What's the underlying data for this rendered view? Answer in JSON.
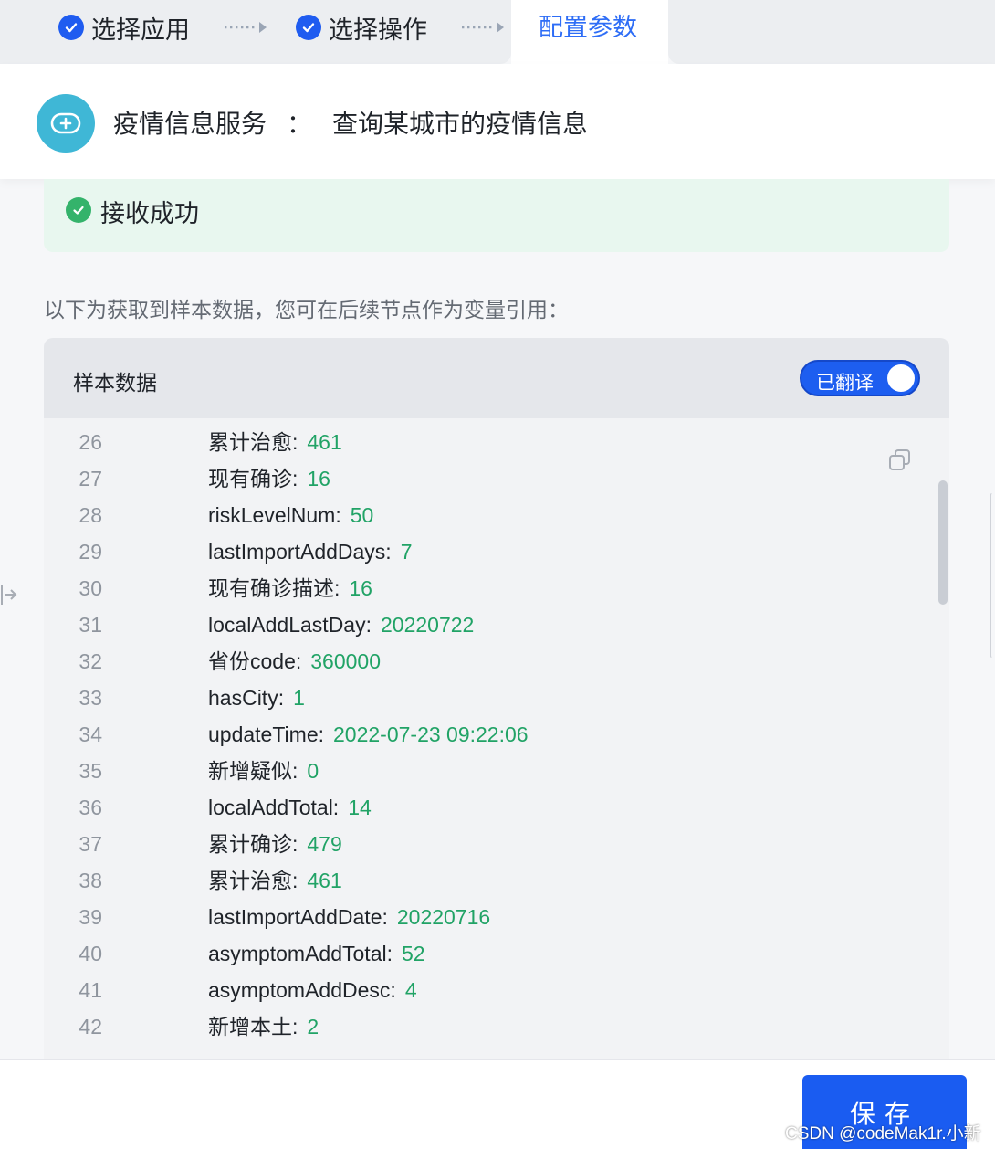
{
  "steps": [
    {
      "label": "选择应用",
      "status": "done"
    },
    {
      "label": "选择操作",
      "status": "done"
    },
    {
      "label": "配置参数",
      "status": "active"
    }
  ],
  "header": {
    "app_name": "疫情信息服务",
    "separator": "：",
    "action_name": "查询某城市的疫情信息",
    "logo_icon": "medical-kit-icon",
    "logo_color": "#3fb7d6"
  },
  "status": {
    "text": "接收成功",
    "icon": "check-circle-icon",
    "color": "#34b36b"
  },
  "description": "以下为获取到样本数据，您可在后续节点作为变量引用：",
  "sample": {
    "title": "样本数据",
    "toggle_label": "已翻译",
    "toggle_on": true,
    "lines": [
      {
        "num": "26",
        "key": "累计治愈:",
        "value": "461"
      },
      {
        "num": "27",
        "key": "现有确诊:",
        "value": "16"
      },
      {
        "num": "28",
        "key": "riskLevelNum:",
        "value": "50"
      },
      {
        "num": "29",
        "key": "lastImportAddDays:",
        "value": "7"
      },
      {
        "num": "30",
        "key": "现有确诊描述:",
        "value": "16"
      },
      {
        "num": "31",
        "key": "localAddLastDay:",
        "value": "20220722"
      },
      {
        "num": "32",
        "key": "省份code:",
        "value": "360000"
      },
      {
        "num": "33",
        "key": "hasCity:",
        "value": "1"
      },
      {
        "num": "34",
        "key": "updateTime:",
        "value": "2022-07-23 09:22:06"
      },
      {
        "num": "35",
        "key": "新增疑似:",
        "value": "0"
      },
      {
        "num": "36",
        "key": "localAddTotal:",
        "value": "14"
      },
      {
        "num": "37",
        "key": "累计确诊:",
        "value": "479"
      },
      {
        "num": "38",
        "key": "累计治愈:",
        "value": "461"
      },
      {
        "num": "39",
        "key": "lastImportAddDate:",
        "value": "20220716"
      },
      {
        "num": "40",
        "key": "asymptomAddTotal:",
        "value": "52"
      },
      {
        "num": "41",
        "key": "asymptomAddDesc:",
        "value": "4"
      },
      {
        "num": "42",
        "key": "新增本土:",
        "value": "2"
      }
    ]
  },
  "footer": {
    "save_label": "保存"
  },
  "watermark": "CSDN @codeMak1r.小新",
  "colors": {
    "accent": "#1a5cf1",
    "value_green": "#21a366"
  }
}
